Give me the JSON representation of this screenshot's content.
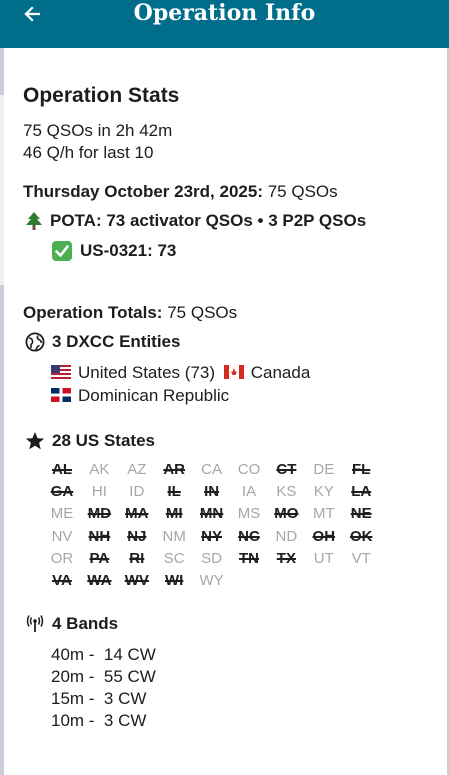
{
  "header": {
    "title": "Operation Info",
    "back_icon": "arrow-left-icon"
  },
  "stats": {
    "title": "Operation Stats",
    "qso_summary": "75 QSOs in 2h 42m",
    "rate": "46 Q/h for last 10"
  },
  "day": {
    "date": "Thursday October 23rd, 2025:",
    "count": "75 QSOs",
    "pota_line": "POTA: 73 activator QSOs • 3 P2P QSOs",
    "park": "US-0321: 73"
  },
  "totals": {
    "label": "Operation Totals:",
    "count": "75 QSOs",
    "dxcc_title": "3 DXCC Entities",
    "dxcc": [
      {
        "name": "United States (73)",
        "flag": "US"
      },
      {
        "name": "Canada",
        "flag": "CA"
      },
      {
        "name": "Dominican Republic",
        "flag": "DO"
      }
    ]
  },
  "us_states": {
    "title": "28 US States",
    "rows": [
      [
        {
          "c": "AL",
          "done": true
        },
        {
          "c": "AK",
          "done": false
        },
        {
          "c": "AZ",
          "done": false
        },
        {
          "c": "AR",
          "done": true
        },
        {
          "c": "CA",
          "done": false
        },
        {
          "c": "CO",
          "done": false
        },
        {
          "c": "CT",
          "done": true
        },
        {
          "c": "DE",
          "done": false
        },
        {
          "c": "FL",
          "done": true
        }
      ],
      [
        {
          "c": "GA",
          "done": true
        },
        {
          "c": "HI",
          "done": false
        },
        {
          "c": "ID",
          "done": false
        },
        {
          "c": "IL",
          "done": true
        },
        {
          "c": "IN",
          "done": true
        },
        {
          "c": "IA",
          "done": false
        },
        {
          "c": "KS",
          "done": false
        },
        {
          "c": "KY",
          "done": false
        },
        {
          "c": "LA",
          "done": true
        }
      ],
      [
        {
          "c": "ME",
          "done": false
        },
        {
          "c": "MD",
          "done": true
        },
        {
          "c": "MA",
          "done": true
        },
        {
          "c": "MI",
          "done": true
        },
        {
          "c": "MN",
          "done": true
        },
        {
          "c": "MS",
          "done": false
        },
        {
          "c": "MO",
          "done": true
        },
        {
          "c": "MT",
          "done": false
        },
        {
          "c": "NE",
          "done": true
        }
      ],
      [
        {
          "c": "NV",
          "done": false
        },
        {
          "c": "NH",
          "done": true
        },
        {
          "c": "NJ",
          "done": true
        },
        {
          "c": "NM",
          "done": false
        },
        {
          "c": "NY",
          "done": true
        },
        {
          "c": "NC",
          "done": true
        },
        {
          "c": "ND",
          "done": false
        },
        {
          "c": "OH",
          "done": true
        },
        {
          "c": "OK",
          "done": true
        }
      ],
      [
        {
          "c": "OR",
          "done": false
        },
        {
          "c": "PA",
          "done": true
        },
        {
          "c": "RI",
          "done": true
        },
        {
          "c": "SC",
          "done": false
        },
        {
          "c": "SD",
          "done": false
        },
        {
          "c": "TN",
          "done": true
        },
        {
          "c": "TX",
          "done": true
        },
        {
          "c": "UT",
          "done": false
        },
        {
          "c": "VT",
          "done": false
        }
      ],
      [
        {
          "c": "VA",
          "done": true
        },
        {
          "c": "WA",
          "done": true
        },
        {
          "c": "WV",
          "done": true
        },
        {
          "c": "WI",
          "done": true
        },
        {
          "c": "WY",
          "done": false
        }
      ]
    ]
  },
  "bands": {
    "title": "4 Bands",
    "items": [
      "40m -  14 CW",
      "20m -  55 CW",
      "15m -  3 CW",
      "10m -  3 CW"
    ]
  },
  "colors": {
    "header": "#006e8a",
    "background": "#c9ced8",
    "tree": "#2e7d32",
    "check": "#4caf50"
  }
}
